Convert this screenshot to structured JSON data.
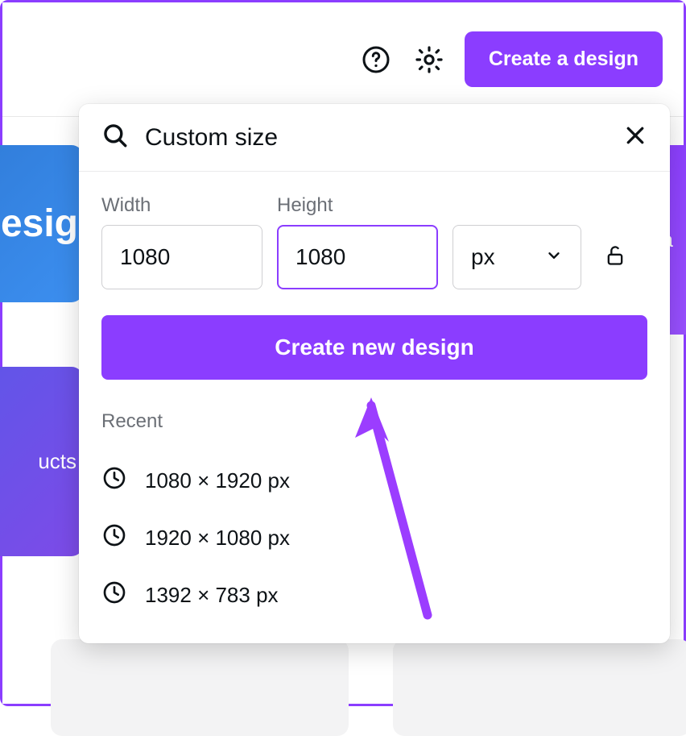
{
  "colors": {
    "accent": "#8b3dff"
  },
  "topbar": {
    "help_icon": "help-circle-icon",
    "settings_icon": "gear-icon",
    "cta_label": "Create a design"
  },
  "background_tiles": {
    "blue_text": "esig",
    "purple_left_text": "ucts",
    "purple_right_text": "oa"
  },
  "popover": {
    "search_icon": "search-icon",
    "title": "Custom size",
    "close_icon": "close-icon",
    "width_label": "Width",
    "width_value": "1080",
    "height_label": "Height",
    "height_value": "1080",
    "unit_value": "px",
    "lock_icon": "lock-open-icon",
    "create_label": "Create new design",
    "recent_label": "Recent",
    "recent_items": [
      {
        "label": "1080 × 1920 px"
      },
      {
        "label": "1920 × 1080 px"
      },
      {
        "label": "1392 × 783 px"
      }
    ]
  }
}
